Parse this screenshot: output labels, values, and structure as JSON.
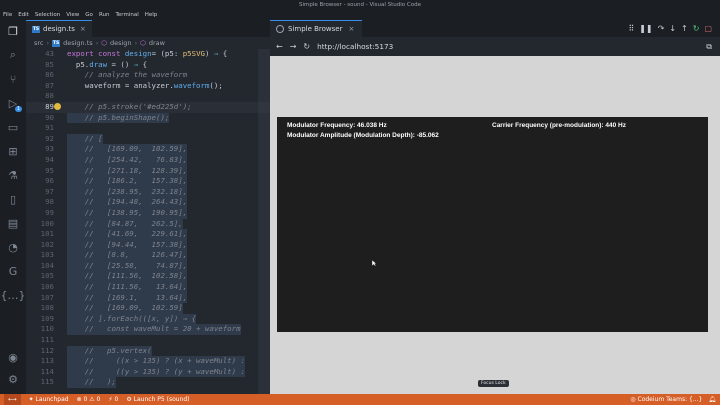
{
  "window": {
    "title": "Simple Browser - sound - Visual Studio Code"
  },
  "menu": [
    "File",
    "Edit",
    "Selection",
    "View",
    "Go",
    "Run",
    "Terminal",
    "Help"
  ],
  "activity": {
    "badge": "1"
  },
  "editor": {
    "tab_label": "design.ts",
    "breadcrumb": [
      "src",
      "design.ts",
      "design",
      "draw"
    ],
    "lines": [
      {
        "n": "43",
        "segs": [
          [
            "kw",
            "export const "
          ],
          [
            "fn",
            "design"
          ],
          [
            "",
            "= ("
          ],
          [
            "",
            "p5: "
          ],
          [
            "ty",
            "p5SVG"
          ],
          [
            "",
            ") "
          ],
          [
            "op",
            "⇒"
          ],
          [
            "",
            " {"
          ]
        ]
      },
      {
        "n": "85",
        "segs": [
          [
            "",
            "  p5."
          ],
          [
            "fn",
            "draw"
          ],
          [
            "",
            "",
            " = () "
          ],
          [
            "op",
            "⇒"
          ],
          [
            "",
            " {"
          ]
        ]
      },
      {
        "n": "86",
        "segs": [
          [
            "cm",
            "    // analyze the waveform"
          ]
        ]
      },
      {
        "n": "87",
        "segs": [
          [
            "",
            "    waveform = analyzer."
          ],
          [
            "fn",
            "waveform"
          ],
          [
            "",
            "();"
          ]
        ]
      },
      {
        "n": "88",
        "segs": [
          [
            "",
            ""
          ]
        ]
      },
      {
        "n": "89",
        "segs": [
          [
            "cm",
            "    // p5.stroke('#ed225d');"
          ]
        ],
        "bulb": true,
        "cursor": true
      },
      {
        "n": "90",
        "segs": [
          [
            "cm",
            "    // p5.beginShape();"
          ]
        ],
        "sel": true
      },
      {
        "n": "91",
        "segs": [
          [
            "",
            ""
          ]
        ],
        "sel": true
      },
      {
        "n": "92",
        "segs": [
          [
            "cm",
            "    // ["
          ]
        ],
        "sel": true
      },
      {
        "n": "93",
        "segs": [
          [
            "cm",
            "    //   [169.09,  102.59],"
          ]
        ],
        "sel": true
      },
      {
        "n": "94",
        "segs": [
          [
            "cm",
            "    //   [254.42,   76.83],"
          ]
        ],
        "sel": true
      },
      {
        "n": "95",
        "segs": [
          [
            "cm",
            "    //   [271.18,  128.39],"
          ]
        ],
        "sel": true
      },
      {
        "n": "96",
        "segs": [
          [
            "cm",
            "    //   [186.2,   157.38],"
          ]
        ],
        "sel": true
      },
      {
        "n": "97",
        "segs": [
          [
            "cm",
            "    //   [238.95,  232.18],"
          ]
        ],
        "sel": true
      },
      {
        "n": "98",
        "segs": [
          [
            "cm",
            "    //   [194.48,  264.43],"
          ]
        ],
        "sel": true
      },
      {
        "n": "99",
        "segs": [
          [
            "cm",
            "    //   [138.95,  190.95],"
          ]
        ],
        "sel": true
      },
      {
        "n": "100",
        "segs": [
          [
            "cm",
            "    //   [84.87,   262.5],"
          ]
        ],
        "sel": true
      },
      {
        "n": "101",
        "segs": [
          [
            "cm",
            "    //   [41.69,   229.61],"
          ]
        ],
        "sel": true
      },
      {
        "n": "102",
        "segs": [
          [
            "cm",
            "    //   [94.44,   157.38],"
          ]
        ],
        "sel": true
      },
      {
        "n": "103",
        "segs": [
          [
            "cm",
            "    //   [8.8,     126.47],"
          ]
        ],
        "sel": true
      },
      {
        "n": "104",
        "segs": [
          [
            "cm",
            "    //   [25.58,    74.87],"
          ]
        ],
        "sel": true
      },
      {
        "n": "105",
        "segs": [
          [
            "cm",
            "    //   [111.56,  102.58],"
          ]
        ],
        "sel": true
      },
      {
        "n": "106",
        "segs": [
          [
            "cm",
            "    //   [111.56,   13.64],"
          ]
        ],
        "sel": true
      },
      {
        "n": "107",
        "segs": [
          [
            "cm",
            "    //   [169.1,    13.64],"
          ]
        ],
        "sel": true
      },
      {
        "n": "108",
        "segs": [
          [
            "cm",
            "    //   [169.09,  102.59]"
          ]
        ],
        "sel": true
      },
      {
        "n": "109",
        "segs": [
          [
            "cm",
            "    // ].forEach(([x, y]) ⇒ {"
          ]
        ],
        "sel": true
      },
      {
        "n": "110",
        "segs": [
          [
            "cm",
            "    //   const waveMult = 20 + waveform"
          ]
        ],
        "sel": true
      },
      {
        "n": "111",
        "segs": [
          [
            "",
            ""
          ]
        ],
        "sel": true
      },
      {
        "n": "112",
        "segs": [
          [
            "cm",
            "    //   p5.vertex("
          ]
        ],
        "sel": true
      },
      {
        "n": "113",
        "segs": [
          [
            "cm",
            "    //     ((x > 135) ? (x + waveMult) :"
          ]
        ],
        "sel": true
      },
      {
        "n": "114",
        "segs": [
          [
            "cm",
            "    //     ((y > 135) ? (y + waveMult) :"
          ]
        ],
        "sel": true
      },
      {
        "n": "115",
        "segs": [
          [
            "cm",
            "    //   );"
          ]
        ],
        "sel": true
      }
    ]
  },
  "browser": {
    "tab_label": "Simple Browser",
    "url": "http://localhost:5173",
    "canvas": {
      "mod_freq": "Modulator Frequency: 46.038 Hz",
      "mod_amp": "Modulator Amplitude (Modulation Depth): -85.062",
      "carrier_freq": "Carrier Frequency (pre-modulation): 440 Hz"
    },
    "focus_lock": "Focus Lock"
  },
  "status": {
    "remote": "",
    "launchpad": "Launchpad",
    "errors": "0",
    "warnings": "0",
    "ports": "0",
    "launch": "Launch P5 (sound)",
    "codeium": "Codeium Teams: {...}"
  },
  "colors": {
    "accent": "#3a8ee6",
    "status_bar": "#d65f28",
    "canvas_bg": "#1e1e1e",
    "viewport_bg": "#d5d5d5"
  }
}
